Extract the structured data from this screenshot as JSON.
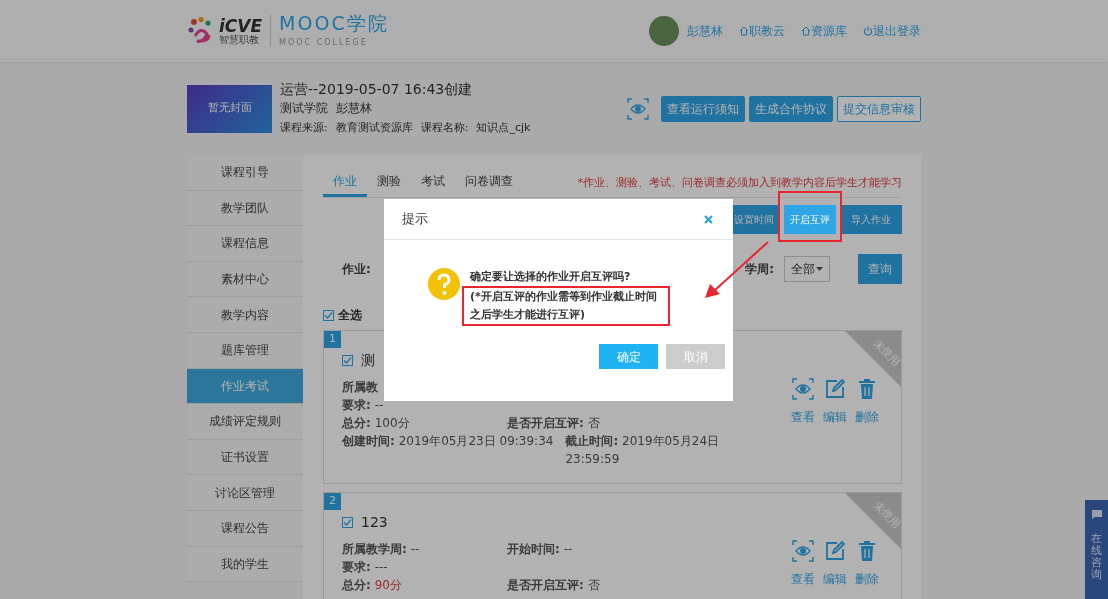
{
  "header": {
    "logo_text": "iCVE",
    "logo_subtext": "智慧职教",
    "brand_title": "MOOC学院",
    "brand_subtitle": "MOOC COLLEGE",
    "user_name": "彭慧林",
    "links": [
      {
        "kind": "home",
        "label": "职教云"
      },
      {
        "kind": "home",
        "label": "资源库"
      },
      {
        "kind": "power",
        "label": "退出登录"
      }
    ]
  },
  "course": {
    "cover_text": "暂无封面",
    "title": "运营--2019-05-07 16:43创建",
    "school": "测试学院",
    "teacher": "彭慧林",
    "source_label": "课程来源:",
    "source": "教育测试资源库",
    "name_label": "课程名称:",
    "name": "知识点_cjk",
    "actions": [
      {
        "kind": "primary",
        "label": "查看运行须知"
      },
      {
        "kind": "primary",
        "label": "生成合作协议"
      },
      {
        "kind": "outline",
        "label": "提交信息审核"
      }
    ]
  },
  "sidebar": {
    "items": [
      {
        "label": "课程引导",
        "selected": false
      },
      {
        "label": "教学团队",
        "selected": false
      },
      {
        "label": "课程信息",
        "selected": false
      },
      {
        "label": "素材中心",
        "selected": false
      },
      {
        "label": "教学内容",
        "selected": false
      },
      {
        "label": "题库管理",
        "selected": false
      },
      {
        "label": "作业考试",
        "selected": true
      },
      {
        "label": "成绩评定规则",
        "selected": false
      },
      {
        "label": "证书设置",
        "selected": false
      },
      {
        "label": "讨论区管理",
        "selected": false
      },
      {
        "label": "课程公告",
        "selected": false
      },
      {
        "label": "我的学生",
        "selected": false
      }
    ]
  },
  "tabs": [
    {
      "label": "作业",
      "selected": true
    },
    {
      "label": "测验",
      "selected": false
    },
    {
      "label": "考试",
      "selected": false
    },
    {
      "label": "问卷调查",
      "selected": false
    }
  ],
  "notice": "*作业、测验、考试、问卷调查必须加入到教学内容后学生才能学习",
  "toolbar": [
    {
      "label": "设置时间",
      "highlighted": false
    },
    {
      "label": "开启互评",
      "highlighted": true
    },
    {
      "label": "导入作业",
      "highlighted": false
    }
  ],
  "filters": {
    "assignment_label": "作业:",
    "week_label": "学周:",
    "week_value": "全部",
    "query_button": "查询"
  },
  "select_all": {
    "label": "全选",
    "checked": true
  },
  "assignments": [
    {
      "number": "1",
      "title": "测",
      "checked": true,
      "status": "未使用",
      "rows": [
        [
          {
            "label": "所属教"
          }
        ],
        [
          {
            "label": "要求:",
            "value": "--"
          }
        ],
        [
          {
            "label": "总分:",
            "value": "100分",
            "highlighted": false
          },
          {
            "label": "是否开启互评:",
            "value": "否"
          }
        ],
        [
          {
            "label": "创建时间:",
            "value": "2019年05月23日 09:39:34"
          },
          {
            "label": "截止时间:",
            "value": "2019年05月24日 23:59:59"
          }
        ]
      ],
      "actions": [
        {
          "kind": "view",
          "label": "查看"
        },
        {
          "kind": "edit",
          "label": "编辑"
        },
        {
          "kind": "delete",
          "label": "删除"
        }
      ]
    },
    {
      "number": "2",
      "title": "123",
      "checked": true,
      "status": "未使用",
      "rows": [
        [
          {
            "label": "所属教学周:",
            "value": "--"
          },
          {
            "label": "开始时间:",
            "value": "--"
          }
        ],
        [
          {
            "label": "要求:",
            "value": "---"
          }
        ],
        [
          {
            "label": "总分:",
            "value": "90分",
            "highlighted": true
          },
          {
            "label": "是否开启互评:",
            "value": "否"
          }
        ]
      ],
      "actions": [
        {
          "kind": "view",
          "label": "查看"
        },
        {
          "kind": "edit",
          "label": "编辑"
        },
        {
          "kind": "delete",
          "label": "删除"
        }
      ]
    }
  ],
  "modal": {
    "title": "提示",
    "message": "确定要让选择的作业开启互评吗?",
    "note": "(*开启互评的作业需等到作业截止时间之后学生才能进行互评)",
    "note_highlighted": true,
    "buttons": [
      {
        "kind": "primary",
        "label": "确定"
      },
      {
        "kind": "secondary",
        "label": "取消"
      }
    ]
  },
  "chat_widget": {
    "label": "在线咨询"
  }
}
